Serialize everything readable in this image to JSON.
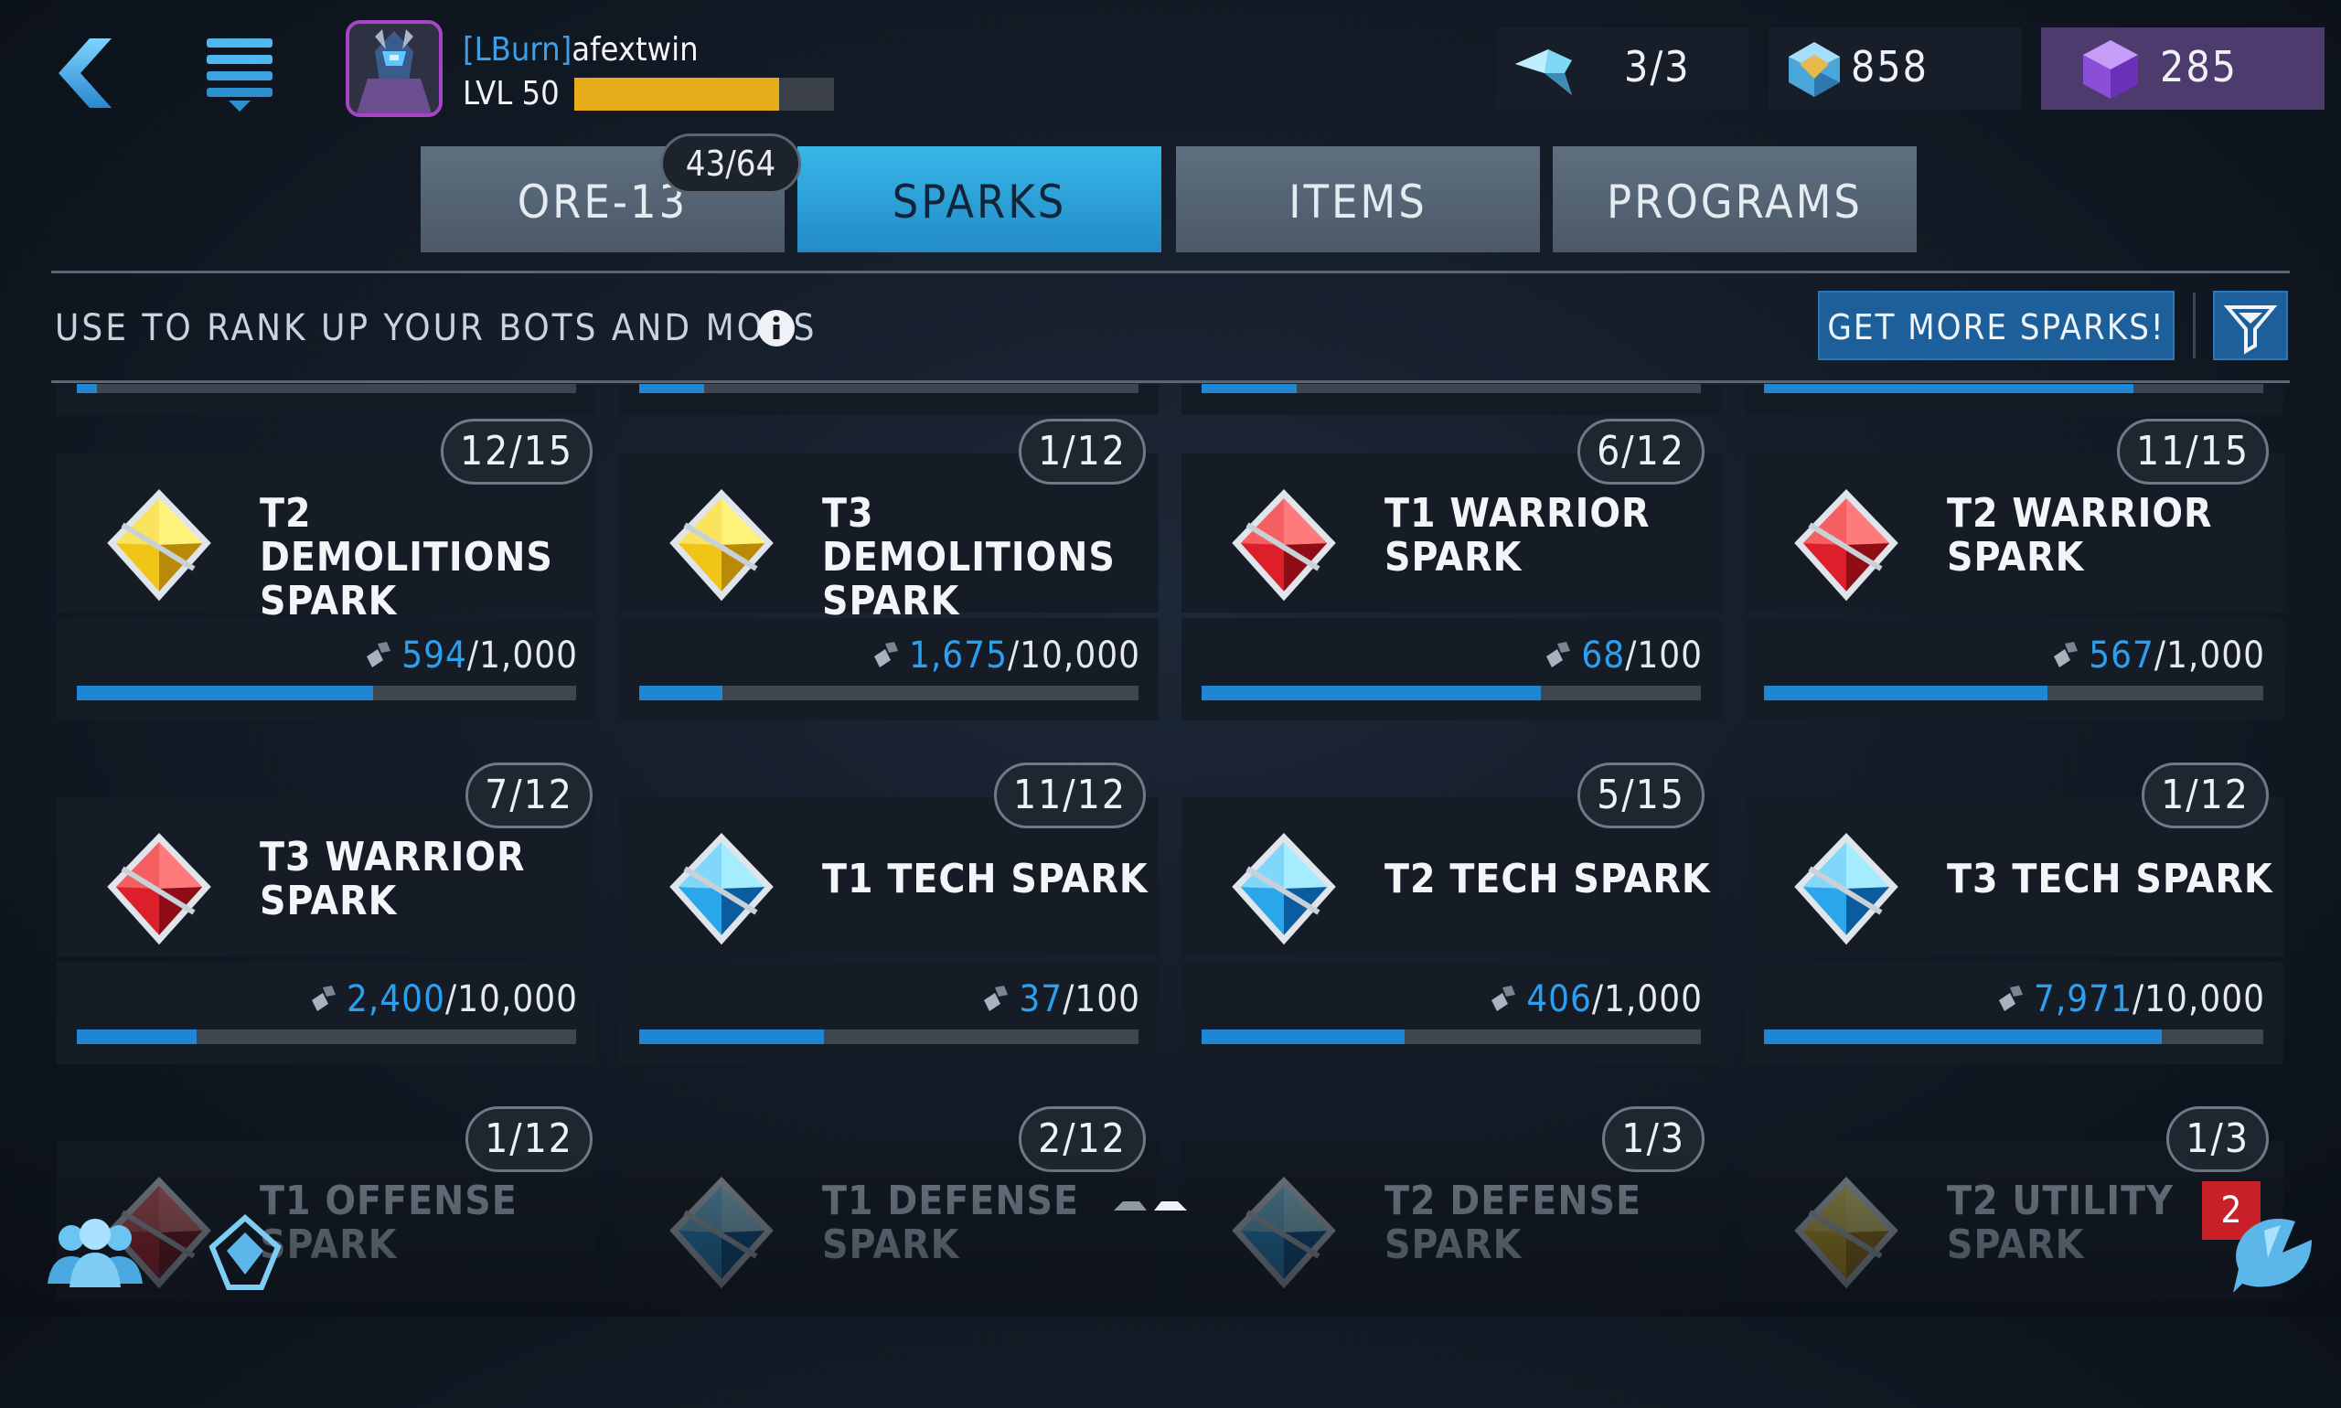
{
  "colors": {
    "accent": "#2b9ff0",
    "active_tab": "#38b6e8",
    "gem_purple": "#8a4fd6",
    "warning_red": "#c8212a"
  },
  "header": {
    "player_tag": "[LBurn]",
    "player_name": "afextwin",
    "level_label": "LVL 50",
    "xp_fraction": 0.79,
    "currencies": {
      "energy": "3/3",
      "shards": "858",
      "gems": "285"
    }
  },
  "tabs": [
    {
      "label": "ORE-13",
      "active": false
    },
    {
      "label": "SPARKS",
      "active": true
    },
    {
      "label": "ITEMS",
      "active": false
    },
    {
      "label": "PROGRAMS",
      "active": false
    }
  ],
  "ore_count": "43/64",
  "subheader": "USE TO RANK UP YOUR BOTS AND MODS",
  "get_more_label": "GET MORE SPARKS!",
  "previous_row_fill": [
    0.04,
    0.13,
    0.19,
    0.74
  ],
  "cards": [
    {
      "title": "T2 DEMOLITIONS SPARK",
      "rank": "12/15",
      "current": "594",
      "max": "1,000",
      "fill": 0.594,
      "color": "yellow"
    },
    {
      "title": "T3 DEMOLITIONS SPARK",
      "rank": "1/12",
      "current": "1,675",
      "max": "10,000",
      "fill": 0.1675,
      "color": "yellow"
    },
    {
      "title": "T1 WARRIOR SPARK",
      "rank": "6/12",
      "current": "68",
      "max": "100",
      "fill": 0.68,
      "color": "red"
    },
    {
      "title": "T2 WARRIOR SPARK",
      "rank": "11/15",
      "current": "567",
      "max": "1,000",
      "fill": 0.567,
      "color": "red"
    },
    {
      "title": "T3 WARRIOR SPARK",
      "rank": "7/12",
      "current": "2,400",
      "max": "10,000",
      "fill": 0.24,
      "color": "red"
    },
    {
      "title": "T1 TECH SPARK",
      "rank": "11/12",
      "current": "37",
      "max": "100",
      "fill": 0.37,
      "color": "blue"
    },
    {
      "title": "T2 TECH SPARK",
      "rank": "5/15",
      "current": "406",
      "max": "1,000",
      "fill": 0.406,
      "color": "blue"
    },
    {
      "title": "T3 TECH SPARK",
      "rank": "1/12",
      "current": "7,971",
      "max": "10,000",
      "fill": 0.7971,
      "color": "blue"
    },
    {
      "title": "T1 OFFENSE SPARK",
      "rank": "1/12",
      "color": "red"
    },
    {
      "title": "T1 DEFENSE SPARK",
      "rank": "2/12",
      "color": "blue"
    },
    {
      "title": "T2 DEFENSE SPARK",
      "rank": "1/3",
      "color": "blue"
    },
    {
      "title": "T2 UTILITY SPARK",
      "rank": "1/3",
      "color": "yellow"
    }
  ],
  "notification_count": "2"
}
